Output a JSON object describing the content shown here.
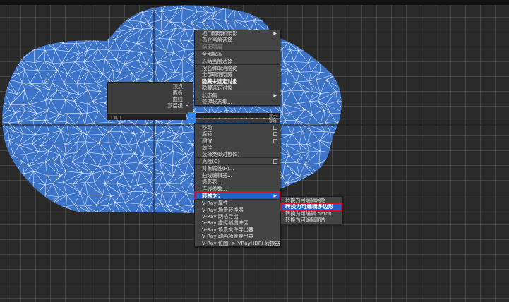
{
  "colors": {
    "accent": "#1f63c4",
    "highlight_border": "#d8102a",
    "mesh": "#3c74c9"
  },
  "quad_left": {
    "items": [
      {
        "label": "顶点",
        "checked": false
      },
      {
        "label": "面板",
        "checked": false
      },
      {
        "label": "曲线",
        "checked": false
      },
      {
        "label": "顶层级",
        "checked": true
      }
    ],
    "checkmark": "✓",
    "footer_label": "工具 1"
  },
  "quad_right_footer": {
    "top_label": "显示",
    "bottom_label": "变换"
  },
  "context_menu": {
    "section_display": [
      {
        "label": "视口照明和阴影",
        "submenu": true,
        "style": "normal"
      },
      {
        "label": "孤立当前选择",
        "style": "normal"
      },
      {
        "label": "结束隔离",
        "style": "dim"
      },
      {
        "label": "全部解冻",
        "style": "normal",
        "sep": true
      },
      {
        "label": "冻结当前选择",
        "style": "normal"
      },
      {
        "label": "按名称取消隐藏",
        "style": "normal",
        "sep": true
      },
      {
        "label": "全部取消隐藏",
        "style": "normal"
      },
      {
        "label": "隐藏未选定对象",
        "style": "bold"
      },
      {
        "label": "隐藏选定对象",
        "style": "normal"
      },
      {
        "label": "状态集",
        "submenu": true,
        "style": "normal",
        "sep": true
      },
      {
        "label": "管理状态集...",
        "style": "normal"
      }
    ],
    "section_transform": [
      {
        "label": "移动",
        "square": true,
        "style": "normal"
      },
      {
        "label": "旋转",
        "square": true,
        "style": "normal"
      },
      {
        "label": "缩放",
        "square": true,
        "style": "normal"
      },
      {
        "label": "选择",
        "style": "normal"
      },
      {
        "label": "选择类似对象(S)",
        "style": "normal"
      },
      {
        "label": "克隆(C)",
        "square": true,
        "style": "normal",
        "sep": true
      },
      {
        "label": "对象属性(P)...",
        "style": "normal",
        "sep": true
      },
      {
        "label": "曲线编辑器...",
        "style": "normal"
      },
      {
        "label": "摄影表...",
        "style": "normal"
      },
      {
        "label": "连线参数...",
        "style": "normal"
      },
      {
        "label": "转换为:",
        "submenu": true,
        "style": "highlight",
        "sep": true
      },
      {
        "label": "V-Ray 属性",
        "style": "normal",
        "sep": true
      },
      {
        "label": "V-Ray 场景转换器",
        "style": "normal"
      },
      {
        "label": "V-Ray 网格导出",
        "style": "normal"
      },
      {
        "label": "V-Ray 虚拟帧缓冲区",
        "style": "normal"
      },
      {
        "label": "V-Ray 场景文件导出器",
        "style": "normal"
      },
      {
        "label": "V-Ray 动画场景导出器",
        "style": "normal"
      },
      {
        "label": "V-Ray 位图 -> VRayHDRI 转换器",
        "style": "normal"
      }
    ]
  },
  "convert_submenu": [
    {
      "label": "转换为可编辑网格",
      "style": "normal"
    },
    {
      "label": "转换为可编辑多边形",
      "style": "highlight"
    },
    {
      "label": "转换为可编辑 patch",
      "style": "normal"
    },
    {
      "label": "转换为可编辑面片",
      "style": "normal"
    }
  ]
}
